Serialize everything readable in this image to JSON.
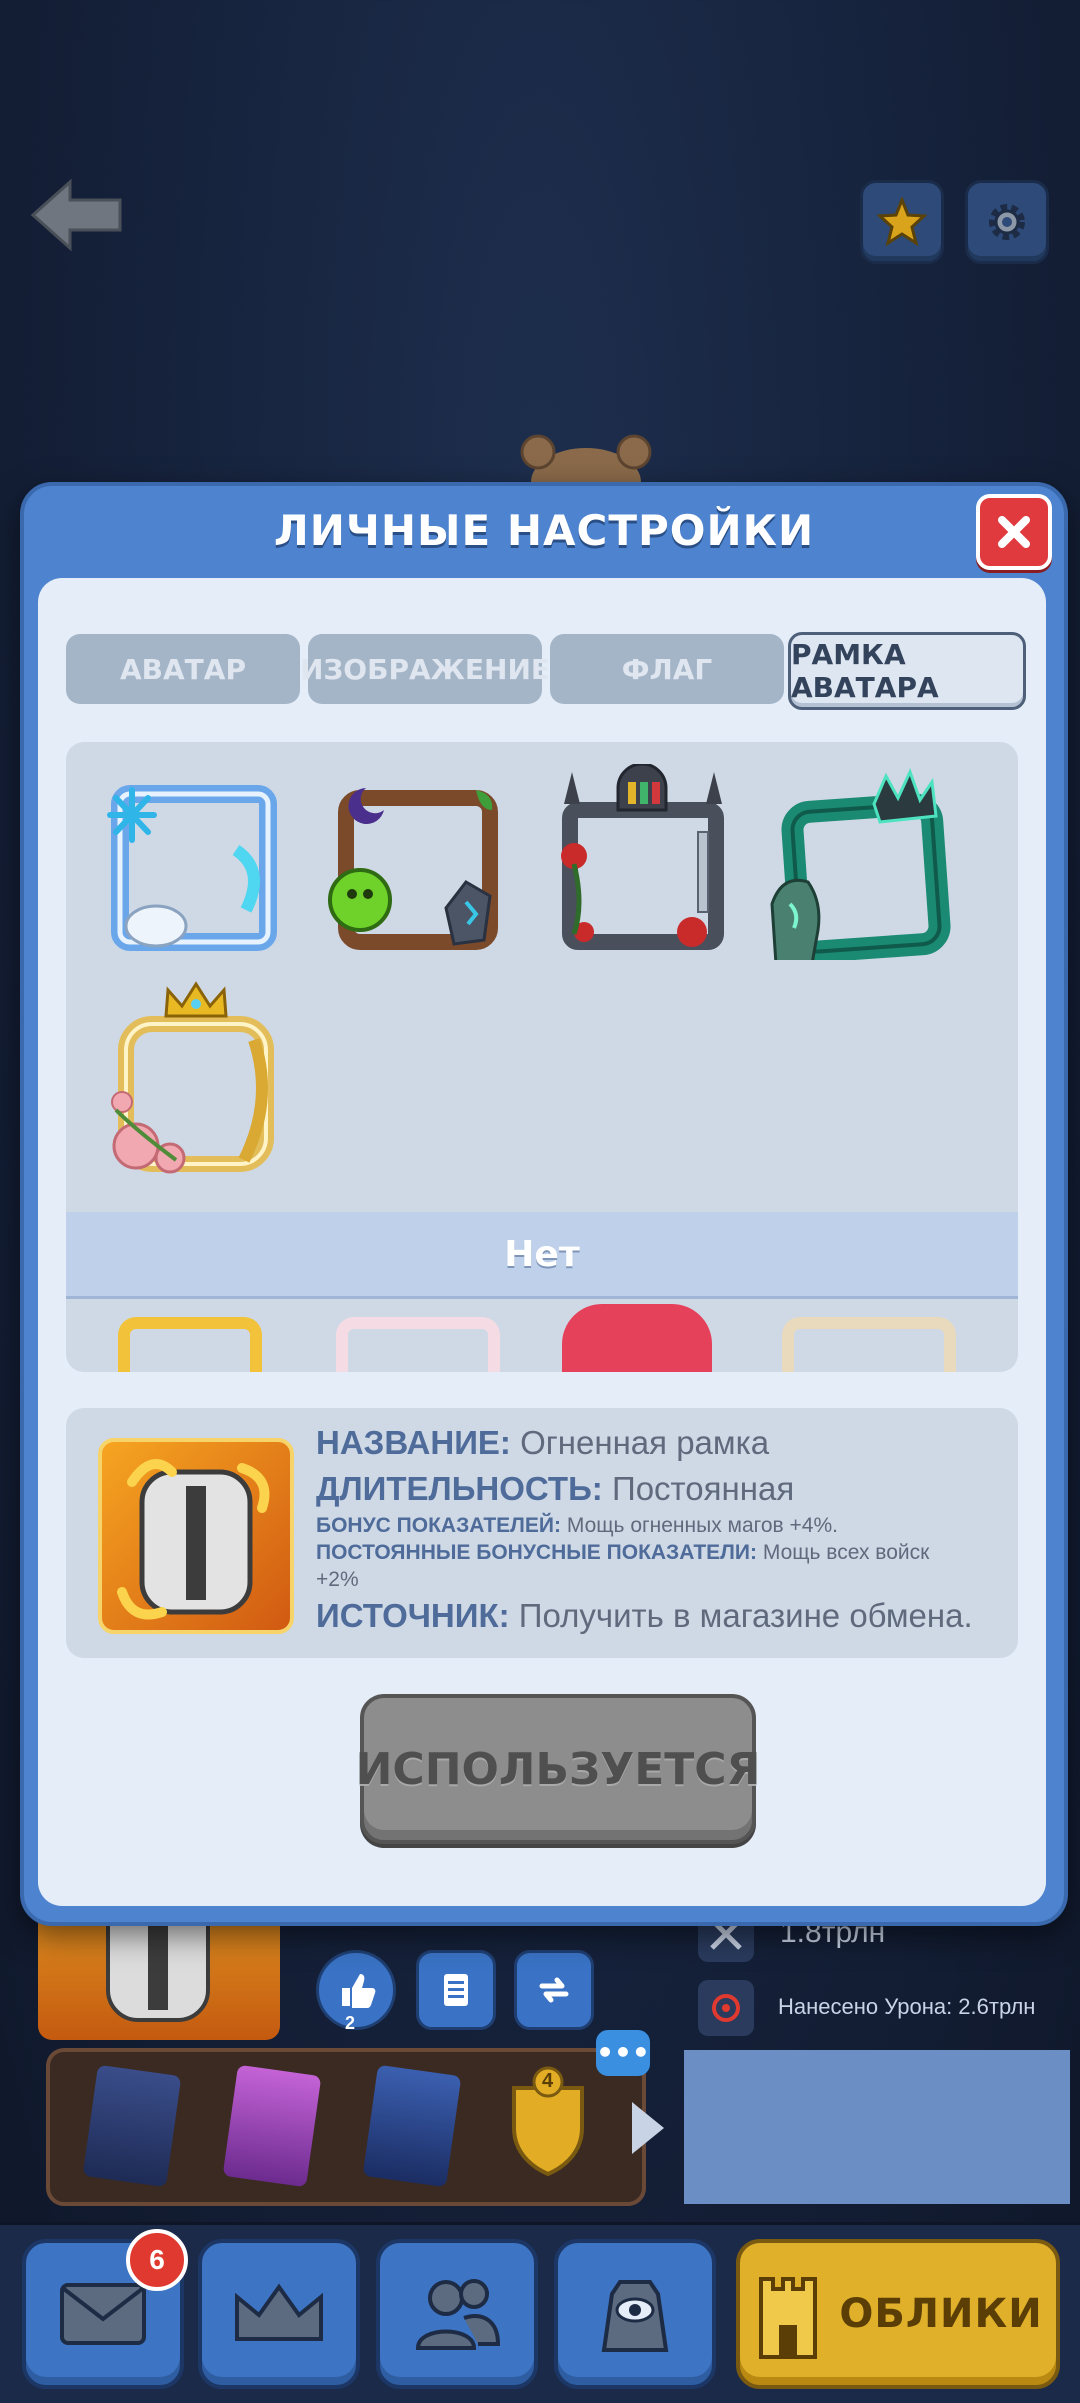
{
  "modal": {
    "title": "ЛИЧНЫЕ НАСТРОЙКИ",
    "tabs": [
      {
        "label": "АВАТАР",
        "active": false
      },
      {
        "label": "ИЗОБРАЖЕНИЕ",
        "active": false
      },
      {
        "label": "ФЛАГ",
        "active": false
      },
      {
        "label": "РАМКА АВАТАРА",
        "active": true
      }
    ],
    "frames": [
      {
        "icon": "ice-frame-icon"
      },
      {
        "icon": "nature-frame-icon"
      },
      {
        "icon": "gothic-frame-icon"
      },
      {
        "icon": "emerald-frame-icon"
      },
      {
        "icon": "royal-rose-frame-icon"
      }
    ],
    "none_label": "Нет",
    "info": {
      "name_label": "НАЗВАНИЕ:",
      "name_value": "Огненная рамка",
      "duration_label": "ДЛИТЕЛЬНОСТЬ:",
      "duration_value": "Постоянная",
      "bonus_label": "БОНУС ПОКАЗАТЕЛЕЙ:",
      "bonus_value": "Мощь огненных магов +4%.",
      "permanent_label": "ПОСТОЯННЫЕ БОНУСНЫЕ ПОКАЗАТЕЛИ:",
      "permanent_value": "Мощь всех войск +2%",
      "source_label": "ИСТОЧНИК:",
      "source_value": "Получить в магазине обмена."
    },
    "action_button": "ИСПОЛЬЗУЕТСЯ"
  },
  "background": {
    "stat_power": "1.8трлн",
    "stat_damage": "Нанесено Урона: 2.6трлн",
    "like_count": "2",
    "badge_level": "4"
  },
  "bottom_nav": {
    "mail_badge": "6",
    "skins_label": "ОБЛИКИ"
  },
  "colors": {
    "modal_blue": "#4d83cf",
    "close_red": "#e03a3f",
    "skins_gold": "#e0b02a",
    "used_gray": "#8d8d8d"
  }
}
